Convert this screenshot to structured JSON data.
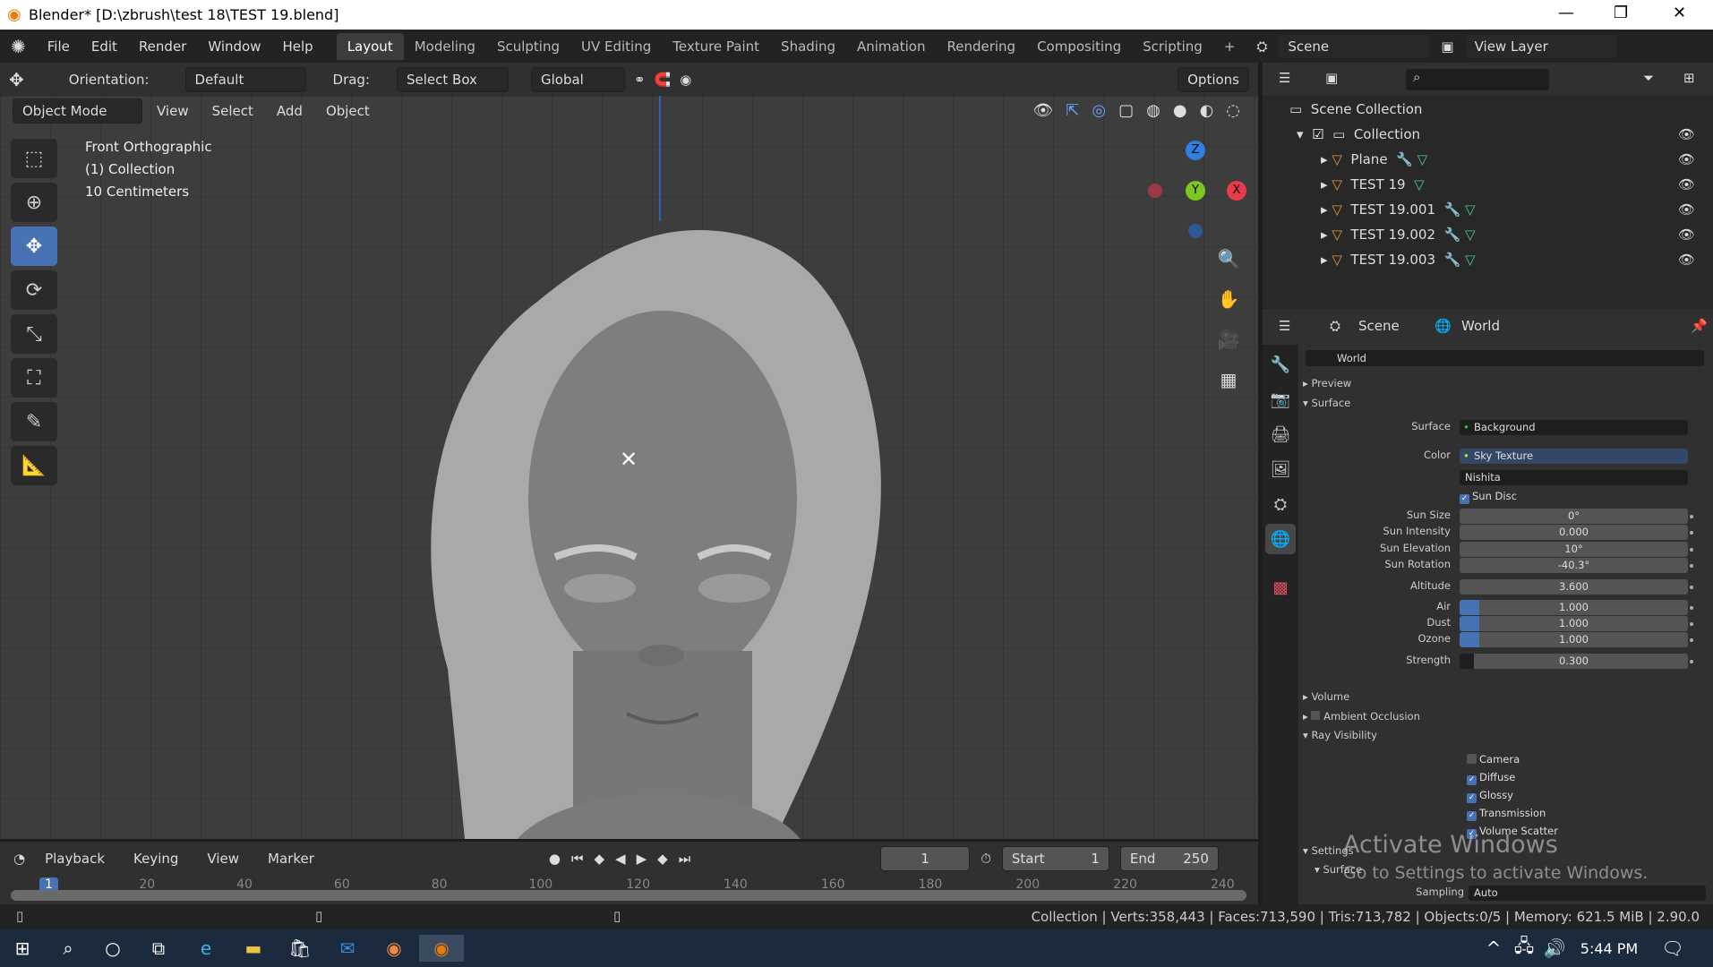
{
  "window": {
    "title": "Blender* [D:\\zbrush\\test 18\\TEST 19.blend]",
    "minimize": "—",
    "maximize": "❐",
    "close": "✕"
  },
  "menu": [
    "File",
    "Edit",
    "Render",
    "Window",
    "Help"
  ],
  "workspaces": [
    "Layout",
    "Modeling",
    "Sculpting",
    "UV Editing",
    "Texture Paint",
    "Shading",
    "Animation",
    "Rendering",
    "Compositing",
    "Scripting"
  ],
  "workspace_add": "+",
  "scene": {
    "name": "Scene",
    "view_layer": "View Layer"
  },
  "tool_header": {
    "orientation_label": "Orientation:",
    "orientation": "Default",
    "drag_label": "Drag:",
    "drag": "Select Box",
    "transform": "Global",
    "options": "Options"
  },
  "viewport": {
    "mode": "Object Mode",
    "menus": [
      "View",
      "Select",
      "Add",
      "Object"
    ],
    "overlay": [
      "Front Orthographic",
      "(1) Collection",
      "10 Centimeters"
    ],
    "gizmo": {
      "z": "Z",
      "y": "Y",
      "x": "X"
    }
  },
  "outliner": {
    "root": "Scene Collection",
    "collection": "Collection",
    "objects": [
      "Plane",
      "TEST 19",
      "TEST 19.001",
      "TEST 19.002",
      "TEST 19.003"
    ]
  },
  "properties": {
    "tabs": [
      "Scene",
      "World"
    ],
    "datablock": "World",
    "sections": {
      "preview": "Preview",
      "surface": "Surface",
      "volume": "Volume",
      "ao": "Ambient Occlusion",
      "ray": "Ray Visibility",
      "settings": "Settings",
      "settings_surface": "Surface"
    },
    "surface_label": "Surface",
    "surface": "Background",
    "color_label": "Color",
    "color": "Sky Texture",
    "sky_type": "Nishita",
    "sun_disc": "Sun Disc",
    "fields": [
      {
        "label": "Sun Size",
        "value": "0°"
      },
      {
        "label": "Sun Intensity",
        "value": "0.000"
      },
      {
        "label": "Sun Elevation",
        "value": "10°"
      },
      {
        "label": "Sun Rotation",
        "value": "-40.3°"
      },
      {
        "label": "Altitude",
        "value": "3.600"
      },
      {
        "label": "Air",
        "value": "1.000"
      },
      {
        "label": "Dust",
        "value": "1.000"
      },
      {
        "label": "Ozone",
        "value": "1.000"
      },
      {
        "label": "Strength",
        "value": "0.300"
      }
    ],
    "ray_visibility": [
      {
        "label": "Camera",
        "checked": false
      },
      {
        "label": "Diffuse",
        "checked": true
      },
      {
        "label": "Glossy",
        "checked": true
      },
      {
        "label": "Transmission",
        "checked": true
      },
      {
        "label": "Volume Scatter",
        "checked": true
      }
    ],
    "sampling_label": "Sampling",
    "sampling": "Auto"
  },
  "timeline": {
    "menus": [
      "Playback",
      "Keying",
      "View",
      "Marker"
    ],
    "current_frame": "1",
    "start_label": "Start",
    "start": "1",
    "end_label": "End",
    "end": "250",
    "ticks": [
      "1",
      "20",
      "40",
      "60",
      "80",
      "100",
      "120",
      "140",
      "160",
      "180",
      "200",
      "220",
      "240"
    ]
  },
  "status": "Collection | Verts:358,443 | Faces:713,590 | Tris:713,782 | Objects:0/5 | Memory: 621.5 MiB | 2.90.0",
  "watermark": {
    "title": "Activate Windows",
    "sub": "Go to Settings to activate Windows."
  },
  "taskbar": {
    "time": "5:44 PM"
  },
  "colors": {
    "accent": "#4772b3",
    "header": "#303030",
    "viewport": "#3d3d3d"
  }
}
